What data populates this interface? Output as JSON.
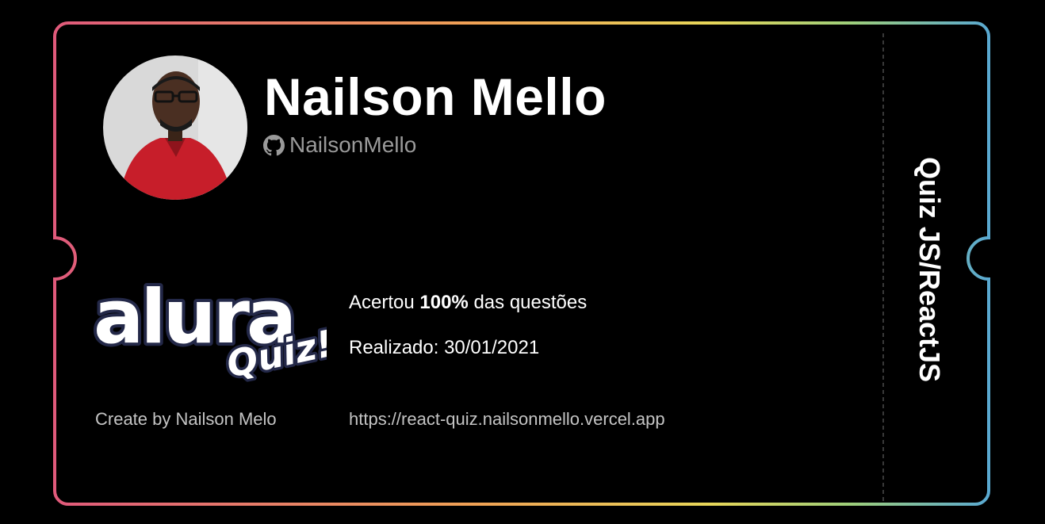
{
  "profile": {
    "name": "Nailson Mello",
    "github_username": "NailsonMello",
    "avatar_icon": "user-avatar-photo"
  },
  "logo": {
    "brand": "alura",
    "sub": "Quiz!"
  },
  "result": {
    "prefix": "Acertou ",
    "score": "100%",
    "suffix": " das questões"
  },
  "date": {
    "label": "Realizado: 30/01/2021"
  },
  "footer": {
    "creator": "Create by Nailson Melo",
    "url": "https://react-quiz.nailsonmello.vercel.app"
  },
  "stub": {
    "title": "Quiz JS/ReactJS"
  },
  "colors": {
    "gradient": [
      "#e05a7b",
      "#f0a255",
      "#e8d659",
      "#9fcf7a",
      "#5aa9d1"
    ],
    "background": "#000000",
    "muted_text": "#9a9a9a",
    "logo_fill": "#ffffff",
    "logo_outline": "#232848"
  }
}
